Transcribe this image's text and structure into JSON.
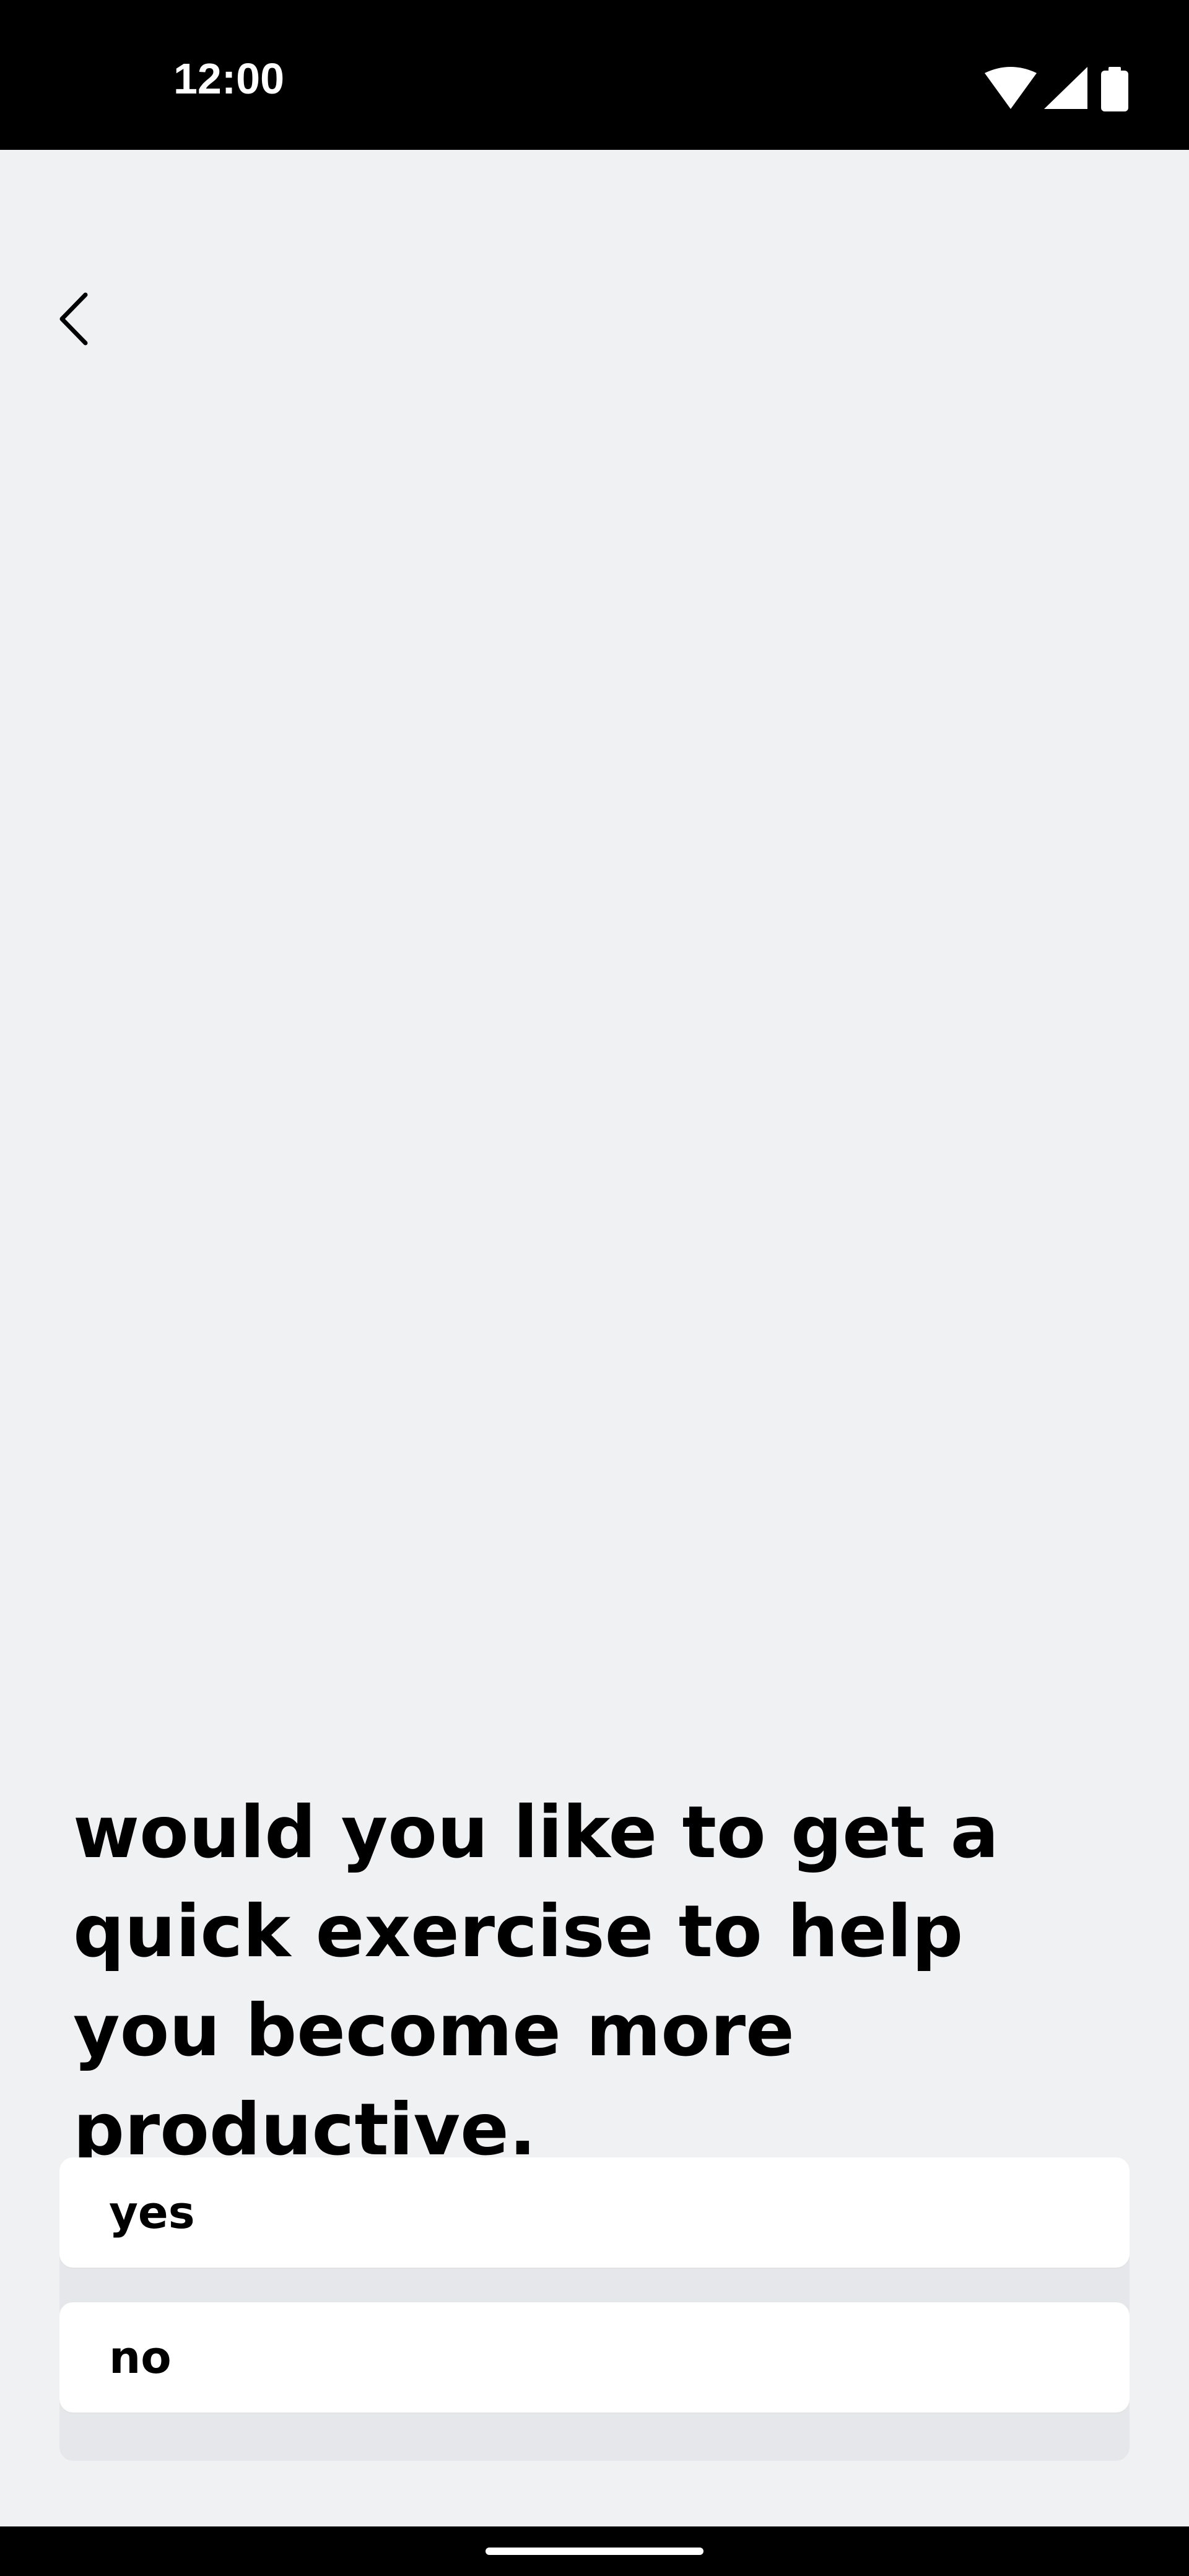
{
  "status_bar": {
    "time": "12:00",
    "icons": [
      "wifi-icon",
      "signal-icon",
      "battery-icon"
    ]
  },
  "header": {
    "back_icon": "chevron-left-icon"
  },
  "main": {
    "question": "would you like to get a quick exercise to help you become more productive.",
    "options": [
      {
        "label": "yes"
      },
      {
        "label": "no"
      }
    ]
  },
  "nav_bar": {
    "home_indicator": "home-indicator"
  },
  "colors": {
    "background": "#f0f1f3",
    "status_bar": "#000000",
    "text": "#000000",
    "option_background": "#ffffff",
    "options_container": "#e6e7ea"
  }
}
